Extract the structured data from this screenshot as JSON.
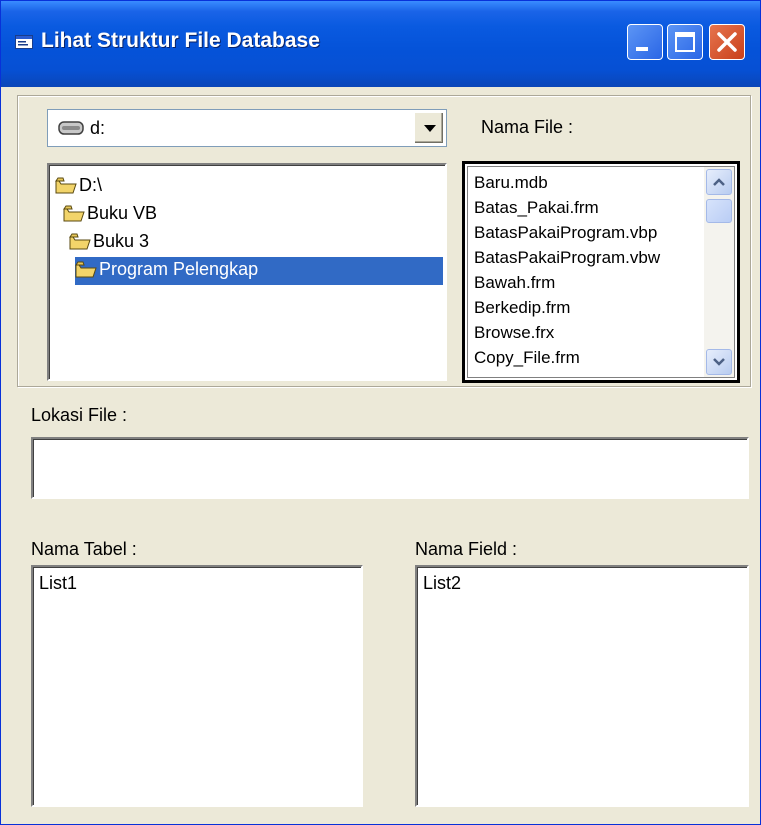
{
  "window": {
    "title": "Lihat Struktur File Database",
    "colors": {
      "titlebar": "#0553d9",
      "client": "#ece9d8",
      "selection": "#316ac5"
    },
    "icons": [
      "form-icon",
      "minimize-icon",
      "maximize-icon",
      "close-icon"
    ]
  },
  "drive": {
    "value": "d:",
    "icon": "drive-icon"
  },
  "labels": {
    "nama_file": "Nama File :",
    "lokasi_file": "Lokasi File :",
    "nama_tabel": "Nama Tabel :",
    "nama_field": "Nama Field :"
  },
  "directories": [
    {
      "label": "D:\\",
      "selected": false
    },
    {
      "label": "Buku VB",
      "selected": false
    },
    {
      "label": "Buku 3",
      "selected": false
    },
    {
      "label": "Program Pelengkap",
      "selected": true
    }
  ],
  "files": [
    "Baru.mdb",
    "Batas_Pakai.frm",
    "BatasPakaiProgram.vbp",
    "BatasPakaiProgram.vbw",
    "Bawah.frm",
    "Berkedip.frm",
    "Browse.frx",
    "Copy_File.frm"
  ],
  "lokasi_file_value": "",
  "lists": {
    "tabel": "List1",
    "field": "List2"
  }
}
